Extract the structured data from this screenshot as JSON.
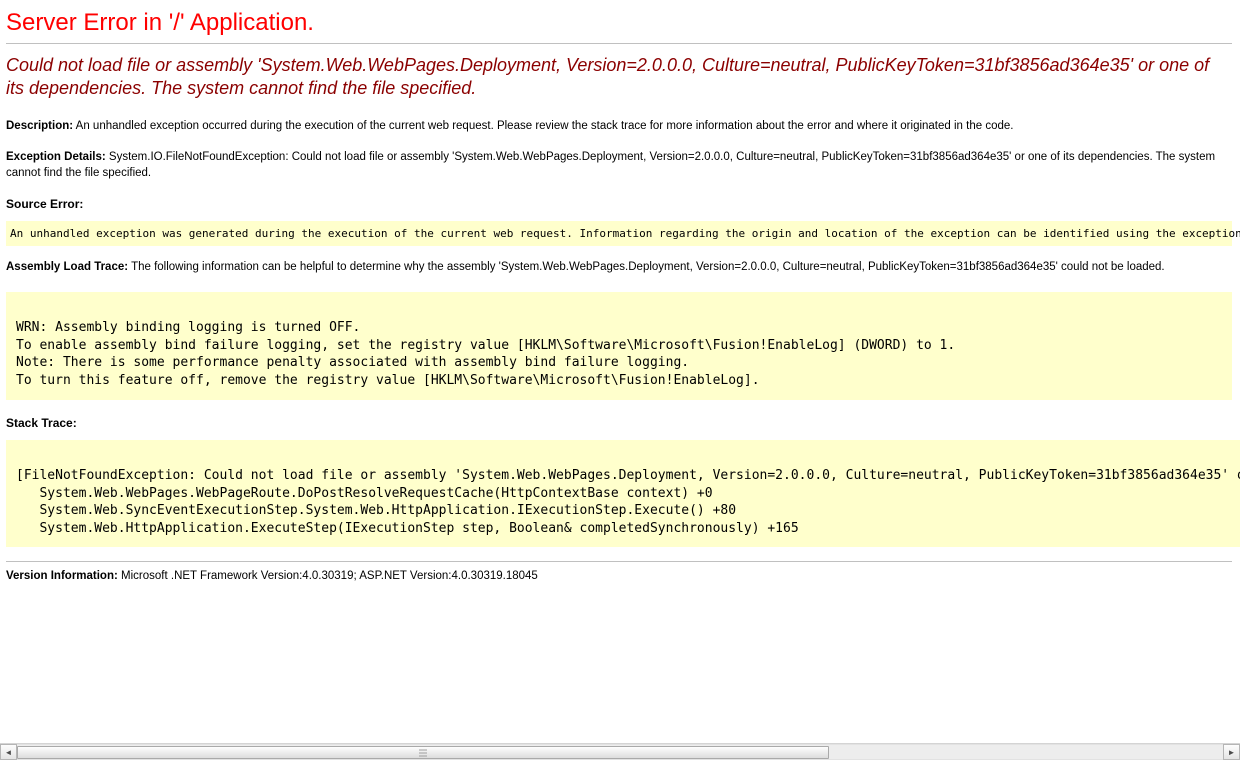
{
  "header": {
    "title": "Server Error in '/' Application."
  },
  "error": {
    "subtitle": "Could not load file or assembly 'System.Web.WebPages.Deployment, Version=2.0.0.0, Culture=neutral, PublicKeyToken=31bf3856ad364e35' or one of its dependencies. The system cannot find the file specified.",
    "description_label": "Description:",
    "description_text": "An unhandled exception occurred during the execution of the current web request. Please review the stack trace for more information about the error and where it originated in the code.",
    "exception_details_label": "Exception Details:",
    "exception_details_text": "System.IO.FileNotFoundException: Could not load file or assembly 'System.Web.WebPages.Deployment, Version=2.0.0.0, Culture=neutral, PublicKeyToken=31bf3856ad364e35' or one of its dependencies. The system cannot find the file specified.",
    "source_error_label": "Source Error:",
    "source_error_box": "An unhandled exception was generated during the execution of the current web request. Information regarding the origin and location of the exception can be identified using the exception stack trace below.",
    "assembly_load_trace_label": "Assembly Load Trace:",
    "assembly_load_trace_text": "The following information can be helpful to determine why the assembly 'System.Web.WebPages.Deployment, Version=2.0.0.0, Culture=neutral, PublicKeyToken=31bf3856ad364e35' could not be loaded.",
    "assembly_load_box": "\nWRN: Assembly binding logging is turned OFF.\nTo enable assembly bind failure logging, set the registry value [HKLM\\Software\\Microsoft\\Fusion!EnableLog] (DWORD) to 1.\nNote: There is some performance penalty associated with assembly bind failure logging.\nTo turn this feature off, remove the registry value [HKLM\\Software\\Microsoft\\Fusion!EnableLog].\n",
    "stack_trace_label": "Stack Trace:",
    "stack_trace_box": "\n[FileNotFoundException: Could not load file or assembly 'System.Web.WebPages.Deployment, Version=2.0.0.0, Culture=neutral, PublicKeyToken=31bf3856ad364e35' or one of its dependencies. The system cannot find the file specified.]\n   System.Web.WebPages.WebPageRoute.DoPostResolveRequestCache(HttpContextBase context) +0\n   System.Web.SyncEventExecutionStep.System.Web.HttpApplication.IExecutionStep.Execute() +80\n   System.Web.HttpApplication.ExecuteStep(IExecutionStep step, Boolean& completedSynchronously) +165\n"
  },
  "version": {
    "label": "Version Information:",
    "text": "Microsoft .NET Framework Version:4.0.30319; ASP.NET Version:4.0.30319.18045"
  },
  "scrollbar": {
    "left_arrow": "◄",
    "right_arrow": "►"
  }
}
